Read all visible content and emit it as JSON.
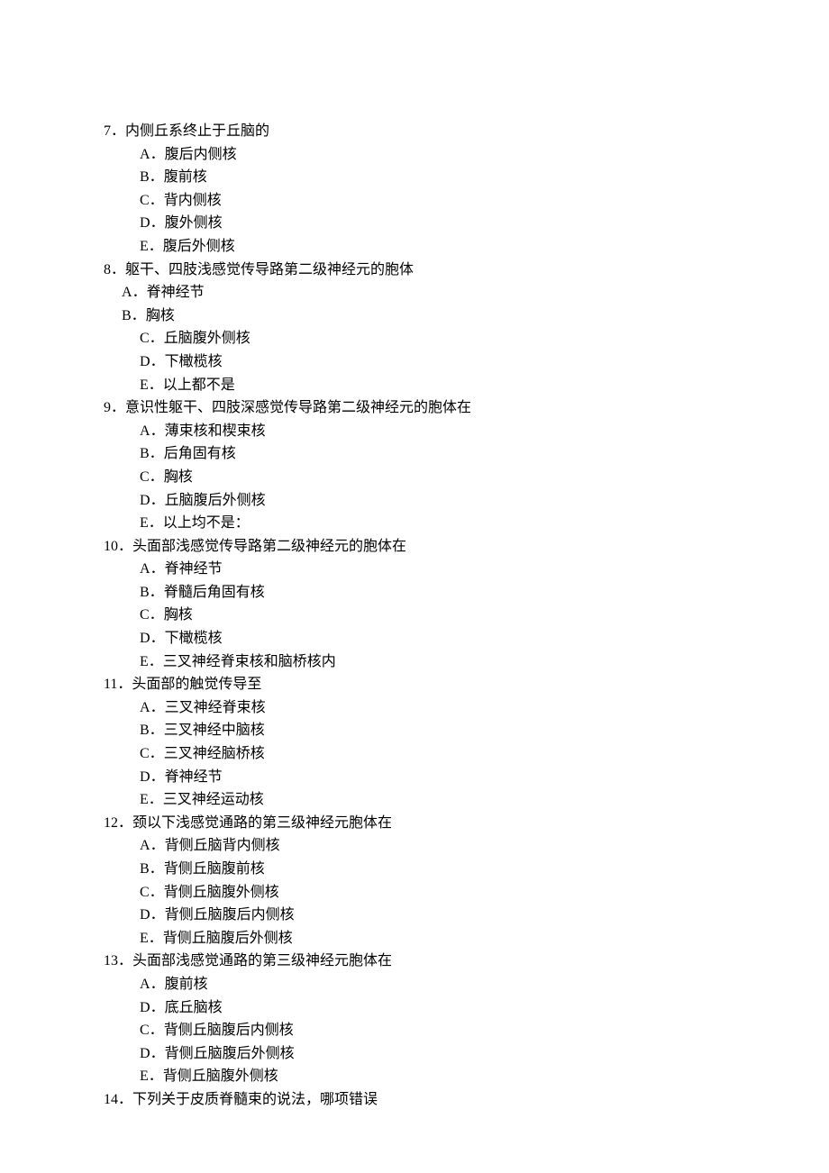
{
  "questions": [
    {
      "number": "7",
      "stem": "内侧丘系终止于丘脑的",
      "options": [
        {
          "letter": "A",
          "text": "腹后内侧核",
          "indent": "opt"
        },
        {
          "letter": "B",
          "text": "腹前核",
          "indent": "opt"
        },
        {
          "letter": "C",
          "text": "背内侧核",
          "indent": "opt"
        },
        {
          "letter": "D",
          "text": "腹外侧核",
          "indent": "opt"
        },
        {
          "letter": "E",
          "text": "腹后外侧核",
          "indent": "opt"
        }
      ]
    },
    {
      "number": "8",
      "stem": "躯干、四肢浅感觉传导路第二级神经元的胞体",
      "options": [
        {
          "letter": "A",
          "text": "脊神经节",
          "indent": "opt-shift"
        },
        {
          "letter": "B",
          "text": "胸核",
          "indent": "opt-shift"
        },
        {
          "letter": "C",
          "text": "丘脑腹外侧核",
          "indent": "opt"
        },
        {
          "letter": "D",
          "text": "下橄榄核",
          "indent": "opt"
        },
        {
          "letter": "E",
          "text": "以上都不是",
          "indent": "opt"
        }
      ]
    },
    {
      "number": "9",
      "stem": "意识性躯干、四肢深感觉传导路第二级神经元的胞体在",
      "options": [
        {
          "letter": "A",
          "text": "薄束核和楔束核",
          "indent": "opt"
        },
        {
          "letter": "B",
          "text": "后角固有核",
          "indent": "opt"
        },
        {
          "letter": "C",
          "text": "胸核",
          "indent": "opt"
        },
        {
          "letter": "D",
          "text": "丘脑腹后外侧核",
          "indent": "opt"
        },
        {
          "letter": "E",
          "text": "以上均不是：",
          "indent": "opt"
        }
      ]
    },
    {
      "number": "10",
      "stem": "头面部浅感觉传导路第二级神经元的胞体在",
      "options": [
        {
          "letter": "A",
          "text": "脊神经节",
          "indent": "opt"
        },
        {
          "letter": "B",
          "text": "脊髓后角固有核",
          "indent": "opt"
        },
        {
          "letter": "C",
          "text": "胸核",
          "indent": "opt"
        },
        {
          "letter": "D",
          "text": "下橄榄核",
          "indent": "opt"
        },
        {
          "letter": "E",
          "text": "三叉神经脊束核和脑桥核内",
          "indent": "opt"
        }
      ]
    },
    {
      "number": "11",
      "stem": "头面部的触觉传导至",
      "options": [
        {
          "letter": "A",
          "text": "三叉神经脊束核",
          "indent": "opt"
        },
        {
          "letter": "B",
          "text": "三叉神经中脑核",
          "indent": "opt"
        },
        {
          "letter": "C",
          "text": "三叉神经脑桥核",
          "indent": "opt"
        },
        {
          "letter": "D",
          "text": "脊神经节",
          "indent": "opt"
        },
        {
          "letter": "E",
          "text": "三叉神经运动核",
          "indent": "opt"
        }
      ]
    },
    {
      "number": "12",
      "stem": "颈以下浅感觉通路的第三级神经元胞体在",
      "options": [
        {
          "letter": "A",
          "text": "背侧丘脑背内侧核",
          "indent": "opt"
        },
        {
          "letter": "B",
          "text": "背侧丘脑腹前核",
          "indent": "opt"
        },
        {
          "letter": "C",
          "text": "背侧丘脑腹外侧核",
          "indent": "opt"
        },
        {
          "letter": "D",
          "text": "背侧丘脑腹后内侧核",
          "indent": "opt"
        },
        {
          "letter": "E",
          "text": "背侧丘脑腹后外侧核",
          "indent": "opt"
        }
      ]
    },
    {
      "number": "13",
      "stem": "头面部浅感觉通路的第三级神经元胞体在",
      "options": [
        {
          "letter": "A",
          "text": "腹前核",
          "indent": "opt"
        },
        {
          "letter": "D",
          "text": "底丘脑核",
          "indent": "opt"
        },
        {
          "letter": "C",
          "text": "背侧丘脑腹后内侧核",
          "indent": "opt"
        },
        {
          "letter": "D",
          "text": "背侧丘脑腹后外侧核",
          "indent": "opt"
        },
        {
          "letter": "E",
          "text": "背侧丘脑腹外侧核",
          "indent": "opt"
        }
      ]
    },
    {
      "number": "14",
      "stem": "下列关于皮质脊髓束的说法，哪项错误",
      "options": []
    }
  ]
}
